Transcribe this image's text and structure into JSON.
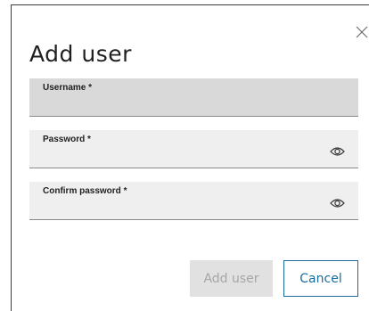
{
  "dialog": {
    "title": "Add user",
    "close_icon": "close-icon",
    "fields": [
      {
        "label": "Username *",
        "value": ""
      },
      {
        "label": "Password *",
        "value": "",
        "icon": "eye-icon"
      },
      {
        "label": "Confirm password *",
        "value": "",
        "icon": "eye-icon"
      }
    ],
    "buttons": {
      "add_label": "Add user",
      "cancel_label": "Cancel"
    }
  },
  "colors": {
    "accent": "#1a6d9c",
    "field_bg": "#efefef",
    "field_active_bg": "#d9d9d9",
    "disabled_button_bg": "#e1e1e1",
    "disabled_text": "#a6a6a6"
  }
}
